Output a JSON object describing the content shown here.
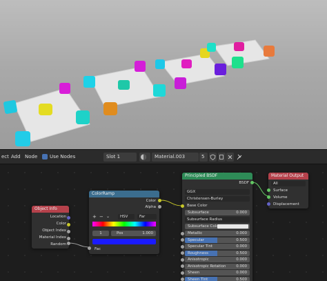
{
  "toolbar": {
    "menu_object": "ect",
    "menu_add": "Add",
    "menu_node": "Node",
    "use_nodes": "Use Nodes",
    "slot": "Slot 1",
    "material": "Material.003",
    "user_count": "5"
  },
  "nodes": {
    "object_info": {
      "title": "Object Info",
      "outputs": [
        "Location",
        "Color",
        "Object Index",
        "Material Index",
        "Random"
      ]
    },
    "color_ramp": {
      "title": "ColorRamp",
      "outputs": [
        "Color",
        "Alpha"
      ],
      "mode": "HSV",
      "interp": "Far",
      "stop_index": "1",
      "pos_label": "Pos",
      "pos_value": "1.000",
      "input": "Fac"
    },
    "bsdf": {
      "title": "Principled BSDF",
      "output": "BSDF",
      "distribution": "GGX",
      "subsurface_method": "Christensen-Burley",
      "base_color": "Base Color",
      "subsurface": {
        "label": "Subsurface",
        "value": "0.000"
      },
      "subsurface_radius": "Subsurface Radius",
      "subsurface_color": "Subsurface Color",
      "params": [
        {
          "label": "Metallic",
          "value": "0.000",
          "fill": 0
        },
        {
          "label": "Specular",
          "value": "0.500",
          "fill": 0.5
        },
        {
          "label": "Specular Tint",
          "value": "0.000",
          "fill": 0
        },
        {
          "label": "Roughness",
          "value": "0.500",
          "fill": 0.5
        },
        {
          "label": "Anisotropic",
          "value": "0.000",
          "fill": 0
        },
        {
          "label": "Anisotropic Rotation",
          "value": "0.000",
          "fill": 0
        },
        {
          "label": "Sheen",
          "value": "0.000",
          "fill": 0
        },
        {
          "label": "Sheen Tint",
          "value": "0.500",
          "fill": 0.5
        }
      ]
    },
    "material_output": {
      "title": "Material Output",
      "target": "All",
      "inputs": [
        "Surface",
        "Volume",
        "Displacement"
      ]
    }
  },
  "colors": {
    "cube_cyan": "#1ec8e0",
    "cube_magenta": "#e01ec0",
    "cube_yellow": "#e0d61e",
    "cube_orange": "#e08c1e",
    "cube_purple": "#7a1ee0",
    "cube_green": "#1ee08c"
  }
}
